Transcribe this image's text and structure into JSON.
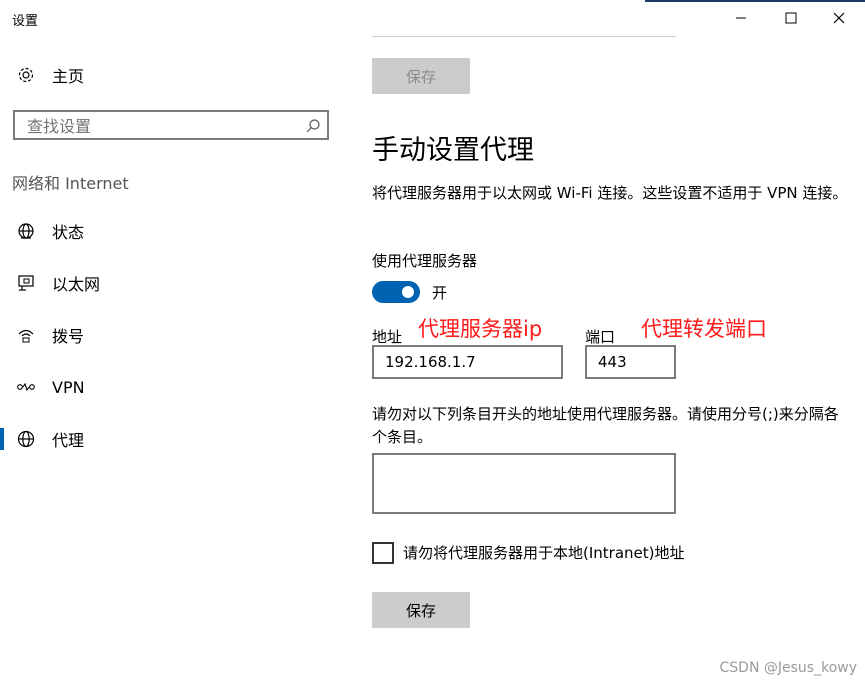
{
  "window": {
    "title": "设置",
    "controls": [
      "minimize-icon",
      "maximize-icon",
      "close-icon"
    ]
  },
  "sidebar": {
    "home": {
      "label": "主页",
      "icon": "gear-icon"
    },
    "search": {
      "placeholder": "查找设置",
      "icon": "search-icon"
    },
    "section_label": "网络和 Internet",
    "items": [
      {
        "label": "状态",
        "icon": "globe-status-icon",
        "active": false
      },
      {
        "label": "以太网",
        "icon": "ethernet-icon",
        "active": false
      },
      {
        "label": "拨号",
        "icon": "dialup-icon",
        "active": false
      },
      {
        "label": "VPN",
        "icon": "vpn-icon",
        "active": false
      },
      {
        "label": "代理",
        "icon": "globe-icon",
        "active": true
      }
    ]
  },
  "main": {
    "save_label": "保存",
    "title": "手动设置代理",
    "description": "将代理服务器用于以太网或 Wi-Fi 连接。这些设置不适用于 VPN 连接。",
    "use_proxy_label": "使用代理服务器",
    "toggle_state": "开",
    "toggle_on": true,
    "address_label": "地址",
    "address_value": "192.168.1.7",
    "port_label": "端口",
    "port_value": "443",
    "exclude_description": "请勿对以下列条目开头的地址使用代理服务器。请使用分号(;)来分隔各个条目。",
    "exclude_value": "",
    "local_checkbox_label": "请勿将代理服务器用于本地(Intranet)地址",
    "local_checkbox_checked": false
  },
  "annotations": {
    "address_note": "代理服务器ip",
    "port_note": "代理转发端口"
  },
  "watermark": "CSDN @Jesus_kowy",
  "colors": {
    "accent": "#0063b1",
    "annotation": "#ff1a1a",
    "button_bg": "#cccccc"
  }
}
